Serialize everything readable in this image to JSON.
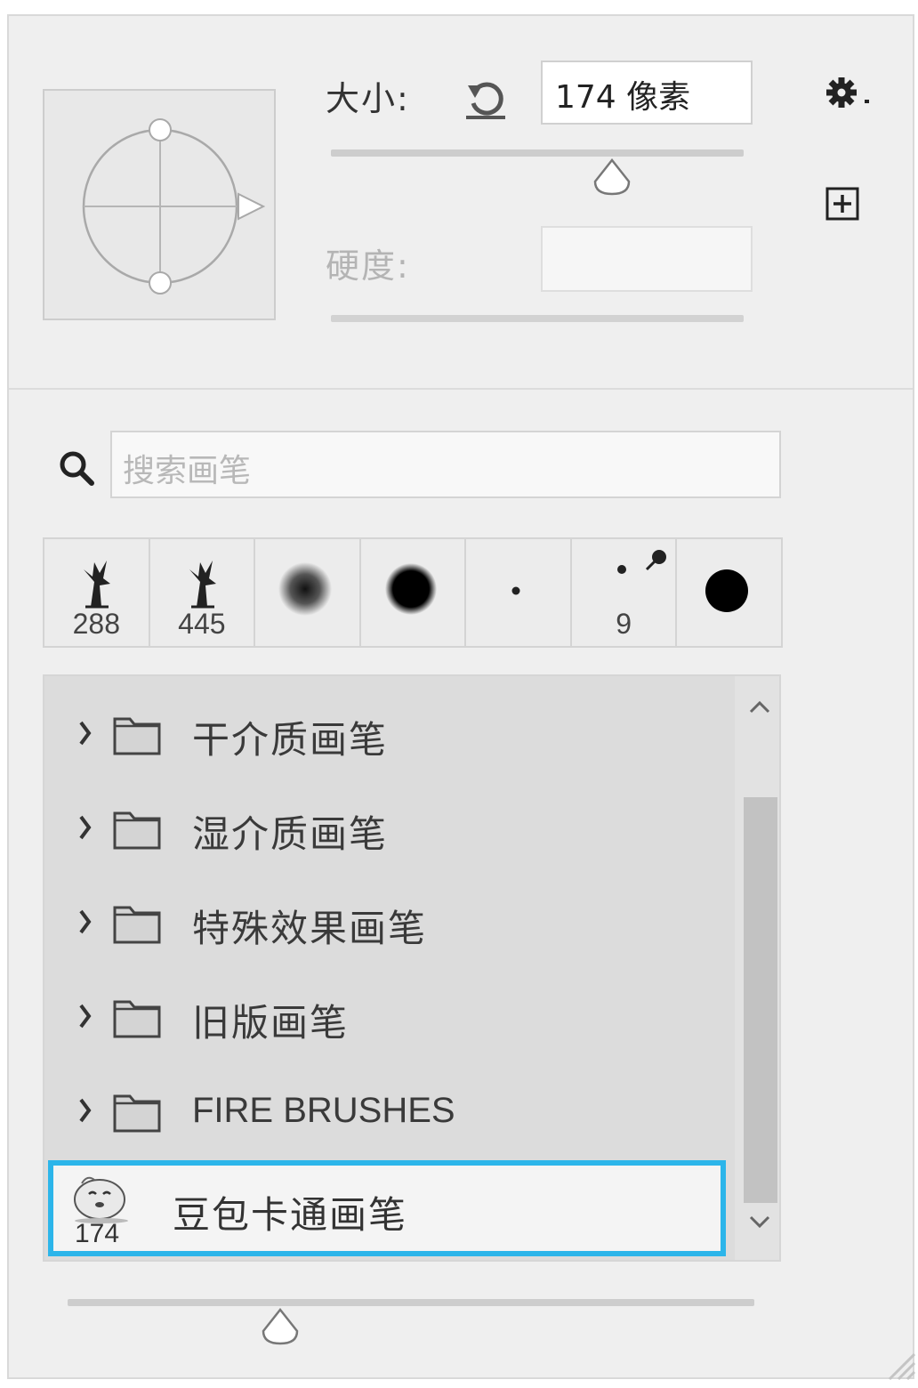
{
  "brush_settings": {
    "size_label": "大小:",
    "size_value": "174 像素",
    "hardness_label": "硬度:",
    "hardness_value": "",
    "size_slider_fraction": 0.68,
    "hardness_slider_fraction": null
  },
  "search": {
    "placeholder": "搜索画笔"
  },
  "recent_brushes": [
    {
      "label": "288",
      "icon": "tree-brush-icon"
    },
    {
      "label": "445",
      "icon": "tree-brush-icon"
    },
    {
      "label": "",
      "icon": "soft-round-brush-icon"
    },
    {
      "label": "",
      "icon": "hard-round-fuzzy-brush-icon"
    },
    {
      "label": "",
      "icon": "tiny-dot-brush-icon"
    },
    {
      "label": "9",
      "icon": "pin-dot-brush-icon"
    },
    {
      "label": "",
      "icon": "hard-round-brush-icon"
    }
  ],
  "brush_groups": [
    {
      "name": "干介质画笔"
    },
    {
      "name": "湿介质画笔"
    },
    {
      "name": "特殊效果画笔"
    },
    {
      "name": "旧版画笔"
    },
    {
      "name": "FIRE BRUSHES"
    }
  ],
  "selected_brush": {
    "name": "豆包卡通画笔",
    "count": "174",
    "icon": "cartoon-bun-icon"
  },
  "preview_size_slider_fraction": 0.31,
  "colors": {
    "selection_border": "#2cb5ea",
    "panel_bg": "#efefef",
    "list_bg": "#dcdcdc"
  }
}
